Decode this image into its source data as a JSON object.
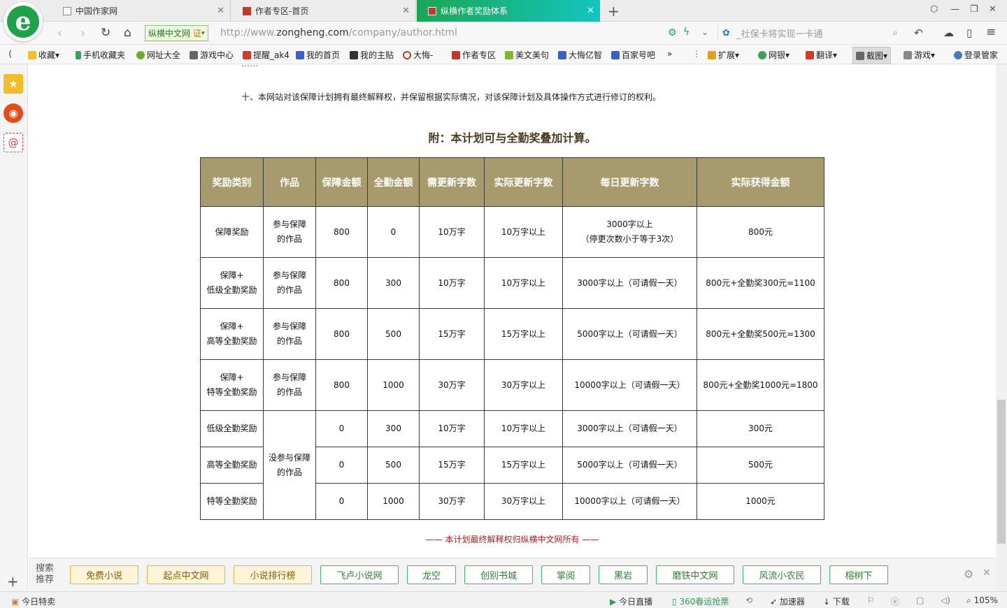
{
  "browser": {
    "tabs": [
      {
        "label": "中国作家网"
      },
      {
        "label": "作者专区-首页"
      },
      {
        "label": "纵横作者奖励体系"
      }
    ],
    "site_badge": "纵横中文网",
    "site_badge_mark": "证",
    "url_prefix": "http://www.",
    "url_domain": "zongheng.com",
    "url_path": "/company/author.html",
    "search_placeholder": "_社保卡将实现一卡通"
  },
  "bookmarks": [
    "收藏",
    "手机收藏夹",
    "网址大全",
    "游戏中心",
    "提醒_ak4",
    "我的首页",
    "我的主贴",
    "大悔",
    "作者专区",
    "美文美句",
    "大悔亿智",
    "百家号吧",
    "»",
    "扩展",
    "网银",
    "翻译",
    "截图",
    "游戏",
    "登录管家"
  ],
  "page": {
    "partial_line": "……",
    "clause10": "十、本网站对该保障计划拥有最终解释权，并保留根据实际情况，对该保障计划及具体操作方式进行修订的权利。",
    "appendix_title": "附：本计划可与全勤奖叠加计算。",
    "table": {
      "headers": [
        "奖励类别",
        "作品",
        "保障金额",
        "全勤金额",
        "需更新字数",
        "实际更新字数",
        "每日更新字数",
        "实际获得金额"
      ],
      "work_participating": "参与保障的作品",
      "work_not_participating": "没参与保障的作品",
      "rows": [
        {
          "cat": "保障奖励",
          "guarantee": "800",
          "attend": "0",
          "need": "10万字",
          "actual": "10万字以上",
          "daily": "3000字以上\n（停更次数小于等于3次）",
          "earn": "800元"
        },
        {
          "cat": "保障+\n低级全勤奖励",
          "guarantee": "800",
          "attend": "300",
          "need": "10万字",
          "actual": "10万字以上",
          "daily": "3000字以上（可请假一天）",
          "earn": "800元+全勤奖300元=1100"
        },
        {
          "cat": "保障+\n高等全勤奖励",
          "guarantee": "800",
          "attend": "500",
          "need": "15万字",
          "actual": "15万字以上",
          "daily": "5000字以上（可请假一天）",
          "earn": "800元+全勤奖500元=1300"
        },
        {
          "cat": "保障+\n特等全勤奖励",
          "guarantee": "800",
          "attend": "1000",
          "need": "30万字",
          "actual": "30万字以上",
          "daily": "10000字以上（可请假一天）",
          "earn": "800元+全勤奖1000元=1800"
        },
        {
          "cat": "低级全勤奖励",
          "guarantee": "0",
          "attend": "300",
          "need": "10万字",
          "actual": "10万字以上",
          "daily": "3000字以上（可请假一天）",
          "earn": "300元"
        },
        {
          "cat": "高等全勤奖励",
          "guarantee": "0",
          "attend": "500",
          "need": "15万字",
          "actual": "15万字以上",
          "daily": "5000字以上（可请假一天）",
          "earn": "500元"
        },
        {
          "cat": "特等全勤奖励",
          "guarantee": "0",
          "attend": "1000",
          "need": "30万字",
          "actual": "30万字以上",
          "daily": "10000字以上（可请假一天）",
          "earn": "1000元"
        }
      ]
    },
    "footer": "—— 本计划最终解释权归纵横中文网所有 ——"
  },
  "search_recommend": {
    "title": "搜索推荐",
    "items": [
      {
        "label": "免费小说",
        "style": "yellow"
      },
      {
        "label": "起点中文网",
        "style": "yellow"
      },
      {
        "label": "小说排行榜",
        "style": "yellow"
      },
      {
        "label": "飞卢小说网",
        "style": "green"
      },
      {
        "label": "龙空",
        "style": "green"
      },
      {
        "label": "创别书城",
        "style": "green"
      },
      {
        "label": "掌阅",
        "style": "green"
      },
      {
        "label": "黑岩",
        "style": "green"
      },
      {
        "label": "磨铁中文网",
        "style": "green"
      },
      {
        "label": "风流小农民",
        "style": "green"
      },
      {
        "label": "榕树下",
        "style": "green"
      }
    ]
  },
  "statusbar": {
    "left": "今日特卖",
    "live": "今日直播",
    "ticket": "360春运抢票",
    "accel": "加速器",
    "download": "下载",
    "zoom": "105%"
  },
  "colors": {
    "header_bg": "#a79a6c",
    "active_tab_start": "#1aa654",
    "active_tab_end": "#12c6c0",
    "footer_text": "#a8231f"
  }
}
